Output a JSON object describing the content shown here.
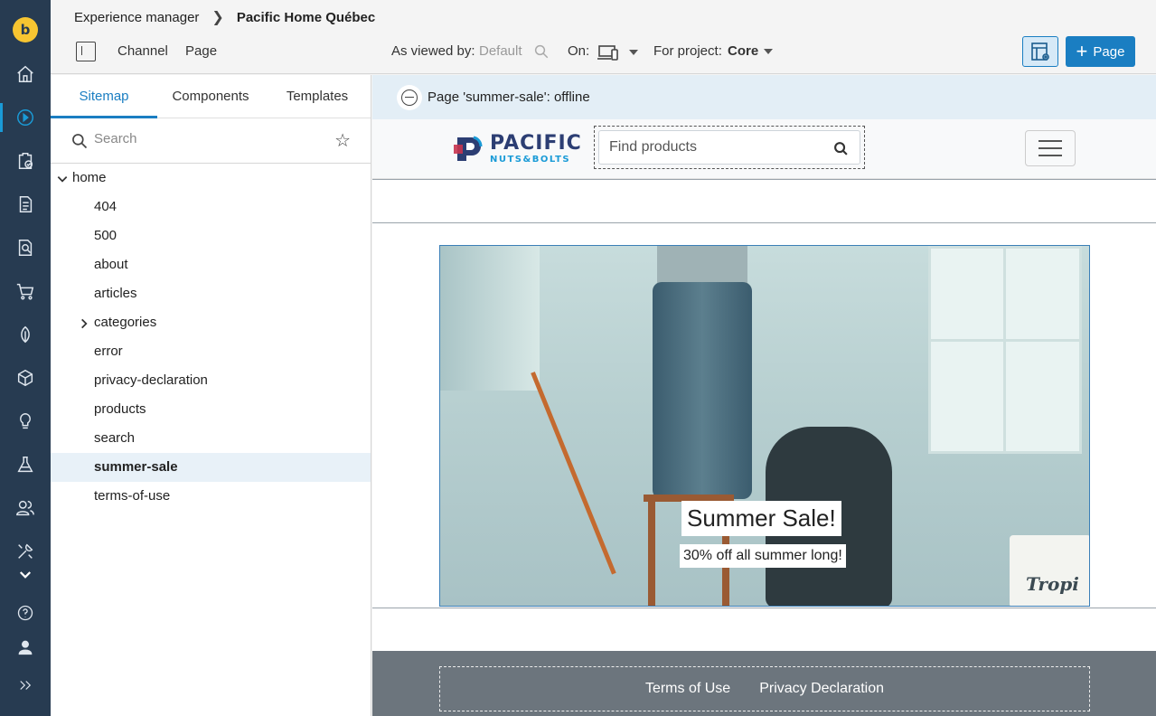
{
  "breadcrumb": {
    "root": "Experience manager",
    "current": "Pacific Home Québec"
  },
  "toolbar": {
    "channel_label": "Channel",
    "page_label": "Page",
    "viewed_by_label": "As viewed by:",
    "viewed_by_value": "Default",
    "on_label": "On:",
    "project_label": "For project:",
    "project_value": "Core",
    "add_page_label": "Page"
  },
  "sidebar": {
    "tabs": [
      "Sitemap",
      "Components",
      "Templates"
    ],
    "search_placeholder": "Search",
    "tree": {
      "root": "home",
      "children": [
        "404",
        "500",
        "about",
        "articles",
        "categories",
        "error",
        "privacy-declaration",
        "products",
        "search",
        "summer-sale",
        "terms-of-use"
      ]
    }
  },
  "status": {
    "text": "Page 'summer-sale': offline"
  },
  "site": {
    "brand_line1": "PACIFIC",
    "brand_line2": "NUTS&BOLTS",
    "search_placeholder": "Find products",
    "banner_title": "Summer Sale!",
    "banner_subtitle": "30% off all summer long!",
    "bucket_text": "Tropi",
    "footer_links": [
      "Terms of Use",
      "Privacy Declaration"
    ]
  },
  "colors": {
    "rail": "#273b51",
    "accent": "#1a7ec2",
    "logo": "#f7c531"
  }
}
